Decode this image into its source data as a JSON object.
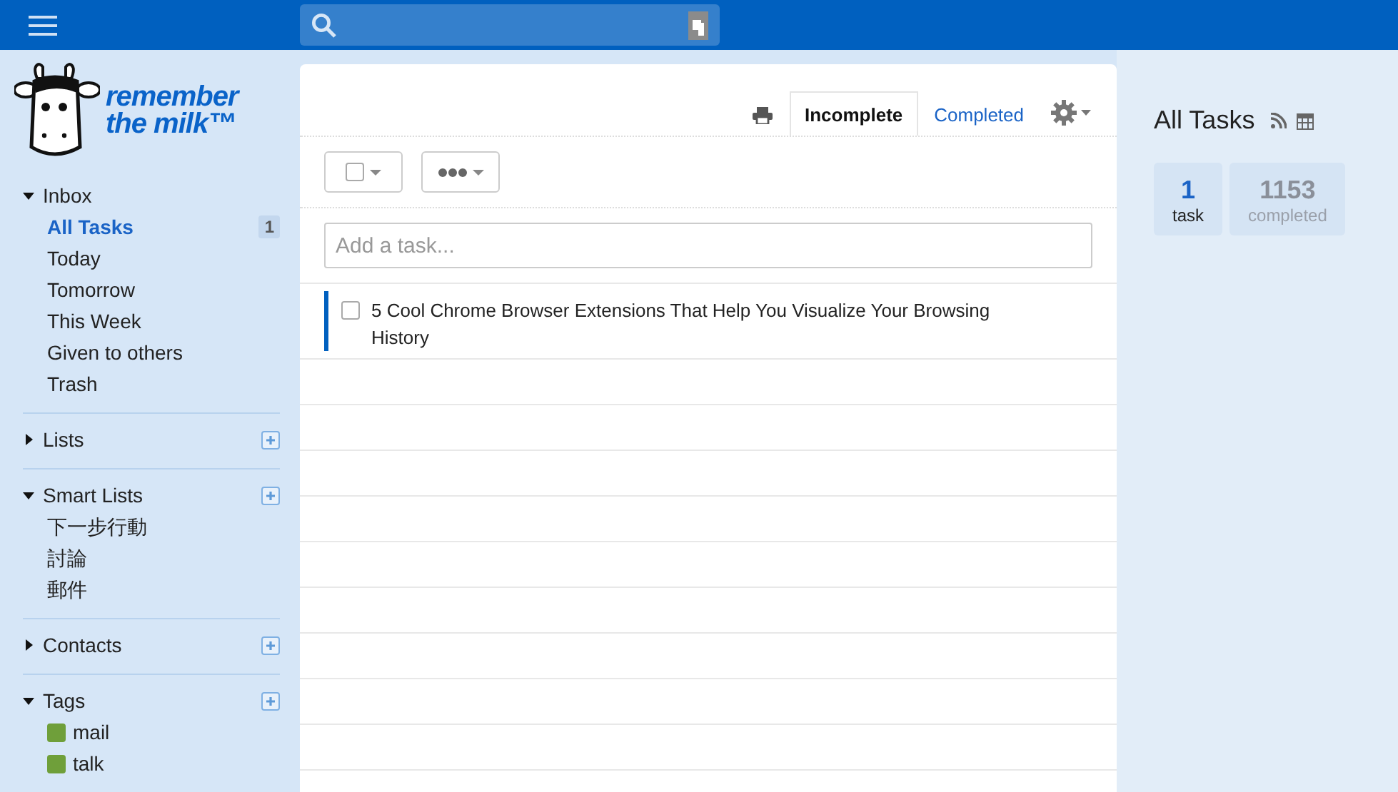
{
  "logo": {
    "line1": "remember",
    "line2": "the milk™"
  },
  "sidebar": {
    "sections": [
      {
        "title": "Inbox",
        "expanded": true,
        "addable": false,
        "items": [
          {
            "label": "All Tasks",
            "selected": true,
            "count": "1"
          },
          {
            "label": "Today",
            "selected": false
          },
          {
            "label": "Tomorrow",
            "selected": false
          },
          {
            "label": "This Week",
            "selected": false
          },
          {
            "label": "Given to others",
            "selected": false
          },
          {
            "label": "Trash",
            "selected": false
          }
        ]
      },
      {
        "title": "Lists",
        "expanded": false,
        "addable": true
      },
      {
        "title": "Smart Lists",
        "expanded": true,
        "addable": true,
        "items": [
          {
            "label": "下一步行動",
            "selected": false
          },
          {
            "label": "討論",
            "selected": false
          },
          {
            "label": "郵件",
            "selected": false
          }
        ]
      },
      {
        "title": "Contacts",
        "expanded": false,
        "addable": true
      },
      {
        "title": "Tags",
        "expanded": true,
        "addable": true,
        "items": [
          {
            "label": "mail",
            "selected": false,
            "color": "#6f9f3a"
          },
          {
            "label": "talk",
            "selected": false,
            "color": "#6f9f3a"
          }
        ]
      }
    ]
  },
  "tabs": [
    {
      "label": "Incomplete",
      "selected": true
    },
    {
      "label": "Completed",
      "selected": false
    }
  ],
  "select_all": {
    "checked": false
  },
  "task_input": {
    "placeholder": "Add a task..."
  },
  "tasks": [
    {
      "title": "5 Cool Chrome Browser Extensions That Help You Visualize Your Browsing History",
      "checked": false,
      "color": "#0060bf"
    }
  ],
  "summary": {
    "title": "All Tasks",
    "stats": [
      {
        "kind": "active",
        "value": "1",
        "label": "task"
      },
      {
        "kind": "completed",
        "value": "1153",
        "label": "completed"
      }
    ]
  }
}
